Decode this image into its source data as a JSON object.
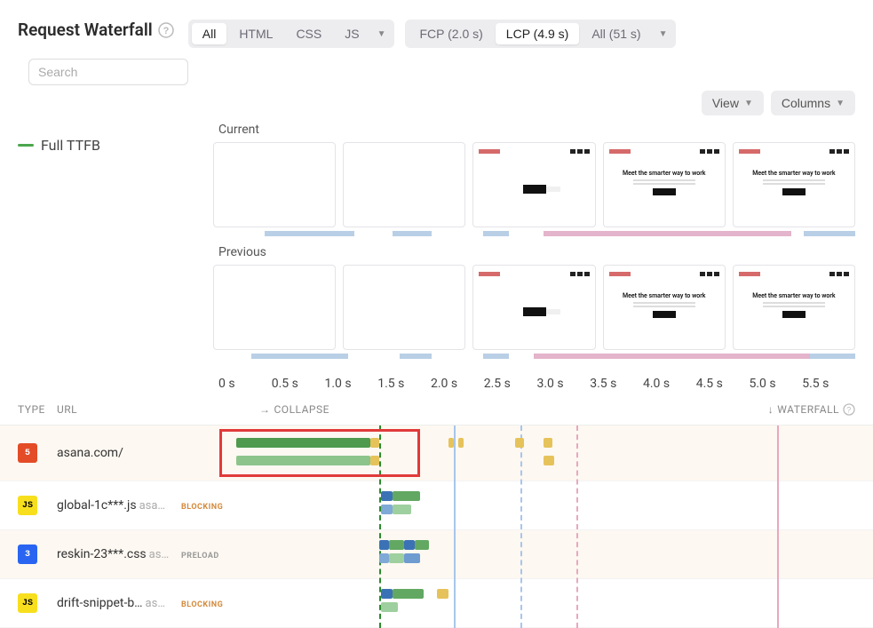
{
  "title": "Request Waterfall",
  "filters": {
    "type": {
      "options": [
        "All",
        "HTML",
        "CSS",
        "JS"
      ],
      "active": "All"
    },
    "metric": {
      "options": [
        "FCP (2.0 s)",
        "LCP (4.9 s)",
        "All (51 s)"
      ],
      "active": "LCP (4.9 s)"
    }
  },
  "search": {
    "placeholder": "Search"
  },
  "actions": {
    "view": "View",
    "columns": "Columns"
  },
  "legend": {
    "full_ttfb": "Full TTFB"
  },
  "filmstrips": {
    "current": "Current",
    "previous": "Previous",
    "hero_text": "Meet the smarter way to work"
  },
  "time_axis": [
    "0 s",
    "0.5 s",
    "1.0 s",
    "1.5 s",
    "2.0 s",
    "2.5 s",
    "3.0 s",
    "3.5 s",
    "4.0 s",
    "4.5 s",
    "5.0 s",
    "5.5 s"
  ],
  "columns": {
    "type": "TYPE",
    "url": "URL",
    "collapse": "COLLAPSE",
    "waterfall": "WATERFALL"
  },
  "rows": [
    {
      "type": "html",
      "badge": "5",
      "url": "asana.com/",
      "domain": "",
      "tag": ""
    },
    {
      "type": "js",
      "badge": "JS",
      "url": "global-1c***.js",
      "domain": "asa…",
      "tag": "BLOCKING"
    },
    {
      "type": "css",
      "badge": "3",
      "url": "reskin-23***.css",
      "domain": "as…",
      "tag": "PRELOAD"
    },
    {
      "type": "js",
      "badge": "JS",
      "url": "drift-snippet-b…",
      "domain": "as…",
      "tag": "BLOCKING"
    }
  ],
  "chart_data": {
    "type": "bar",
    "xlabel": "",
    "ylabel": "",
    "axis_range_s": [
      0,
      5.6
    ],
    "markers_s": {
      "green": 1.33,
      "blue_solid": 2.0,
      "blue_dashed": 2.6,
      "pink_dashed": 3.1,
      "pink_solid": 4.9
    },
    "rows": [
      {
        "url": "asana.com/",
        "current": [
          {
            "name": "ttfb",
            "start": 0.05,
            "end": 1.25,
            "color": "#4f9a4f"
          },
          {
            "name": "download",
            "start": 1.25,
            "end": 1.33,
            "color": "#e6c25a"
          },
          {
            "name": "chunk",
            "start": 1.95,
            "end": 2.0,
            "color": "#e6c25a"
          },
          {
            "name": "chunk",
            "start": 2.04,
            "end": 2.09,
            "color": "#e6c25a"
          },
          {
            "name": "chunk",
            "start": 2.55,
            "end": 2.63,
            "color": "#e6c25a"
          },
          {
            "name": "chunk",
            "start": 2.8,
            "end": 2.88,
            "color": "#e6c25a"
          }
        ],
        "previous": [
          {
            "name": "ttfb",
            "start": 0.05,
            "end": 1.25,
            "color": "#8cc48c"
          },
          {
            "name": "download",
            "start": 1.25,
            "end": 1.33,
            "color": "#e6c25a"
          },
          {
            "name": "chunk",
            "start": 2.8,
            "end": 2.9,
            "color": "#e6c25a"
          }
        ]
      },
      {
        "url": "global-1c***.js",
        "current": [
          {
            "name": "wait",
            "start": 1.35,
            "end": 1.45,
            "color": "#3b72b5"
          },
          {
            "name": "recv",
            "start": 1.45,
            "end": 1.7,
            "color": "#62a862"
          }
        ],
        "previous": [
          {
            "name": "wait",
            "start": 1.35,
            "end": 1.45,
            "color": "#7fa9d6"
          },
          {
            "name": "recv",
            "start": 1.45,
            "end": 1.62,
            "color": "#9ecf9e"
          }
        ]
      },
      {
        "url": "reskin-23***.css",
        "current": [
          {
            "name": "a",
            "start": 1.33,
            "end": 1.42,
            "color": "#3b72b5"
          },
          {
            "name": "b",
            "start": 1.42,
            "end": 1.55,
            "color": "#62a862"
          },
          {
            "name": "c",
            "start": 1.55,
            "end": 1.65,
            "color": "#3b72b5"
          },
          {
            "name": "d",
            "start": 1.65,
            "end": 1.78,
            "color": "#62a862"
          }
        ],
        "previous": [
          {
            "name": "a",
            "start": 1.33,
            "end": 1.42,
            "color": "#7fa9d6"
          },
          {
            "name": "b",
            "start": 1.42,
            "end": 1.55,
            "color": "#9ecf9e"
          },
          {
            "name": "c",
            "start": 1.55,
            "end": 1.7,
            "color": "#6e9bd0"
          }
        ]
      },
      {
        "url": "drift-snippet-b…",
        "current": [
          {
            "name": "a",
            "start": 1.35,
            "end": 1.45,
            "color": "#3b72b5"
          },
          {
            "name": "b",
            "start": 1.45,
            "end": 1.73,
            "color": "#62a862"
          },
          {
            "name": "gap",
            "start": 1.85,
            "end": 1.95,
            "color": "#e6c25a"
          }
        ],
        "previous": [
          {
            "name": "a",
            "start": 1.35,
            "end": 1.5,
            "color": "#9ecf9e"
          }
        ]
      }
    ],
    "highlight_box_s": {
      "start": -0.1,
      "end": 1.7
    },
    "speedindex_current": [
      {
        "start": 0.0,
        "end": 0.08,
        "color": "transparent"
      },
      {
        "start": 0.08,
        "end": 0.22,
        "color": "#b9cfe6"
      },
      {
        "start": 0.22,
        "end": 0.28,
        "color": "transparent"
      },
      {
        "start": 0.28,
        "end": 0.34,
        "color": "#b9cfe6"
      },
      {
        "start": 0.34,
        "end": 0.42,
        "color": "transparent"
      },
      {
        "start": 0.42,
        "end": 0.46,
        "color": "#b9cfe6"
      },
      {
        "start": 0.46,
        "end": 0.515,
        "color": "transparent"
      },
      {
        "start": 0.515,
        "end": 0.9,
        "color": "#e3b4cb"
      },
      {
        "start": 0.9,
        "end": 0.92,
        "color": "transparent"
      },
      {
        "start": 0.92,
        "end": 1.0,
        "color": "#b9cfe6"
      }
    ],
    "speedindex_previous": [
      {
        "start": 0.0,
        "end": 0.06,
        "color": "transparent"
      },
      {
        "start": 0.06,
        "end": 0.21,
        "color": "#b9cfe6"
      },
      {
        "start": 0.21,
        "end": 0.29,
        "color": "transparent"
      },
      {
        "start": 0.29,
        "end": 0.34,
        "color": "#b9cfe6"
      },
      {
        "start": 0.34,
        "end": 0.42,
        "color": "transparent"
      },
      {
        "start": 0.42,
        "end": 0.46,
        "color": "#b9cfe6"
      },
      {
        "start": 0.46,
        "end": 0.5,
        "color": "transparent"
      },
      {
        "start": 0.5,
        "end": 0.93,
        "color": "#e3b4cb"
      },
      {
        "start": 0.93,
        "end": 1.0,
        "color": "#b9cfe6"
      }
    ]
  }
}
